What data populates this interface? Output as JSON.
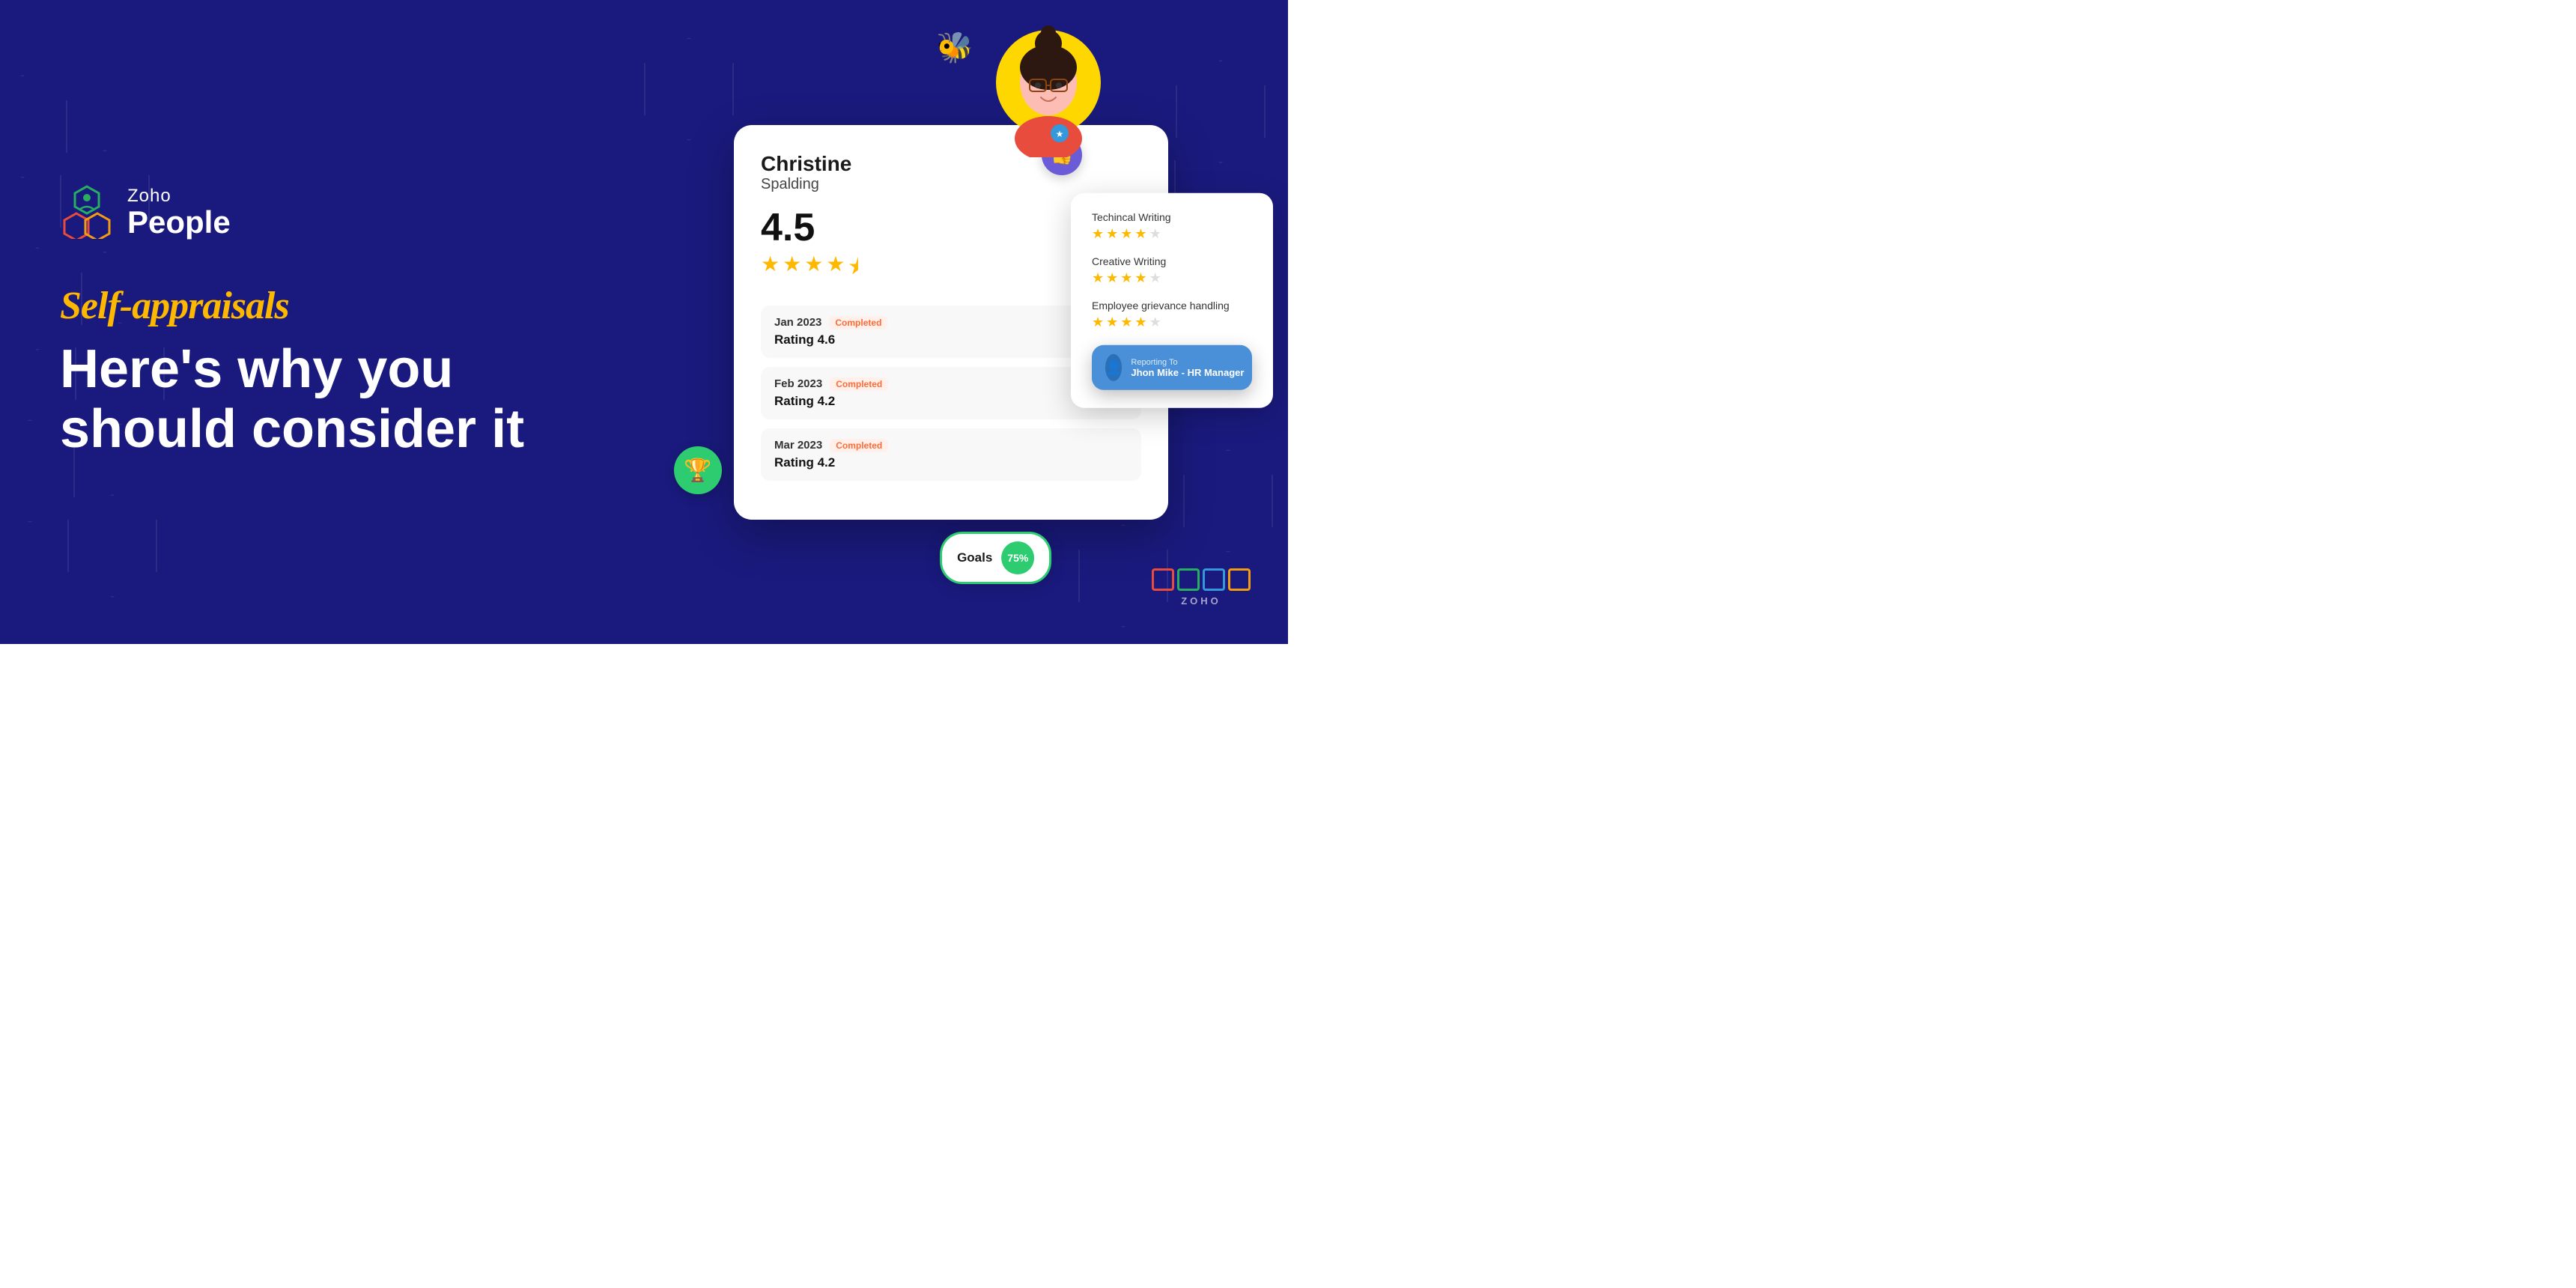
{
  "brand": {
    "zoho": "Zoho",
    "people": "People"
  },
  "hero": {
    "tagline_script": "Self-appraisals",
    "tagline_line1": "Here's why you",
    "tagline_line2": "should consider it"
  },
  "profile": {
    "first_name": "Christine",
    "last_name": "Spalding",
    "overall_rating": "4.5",
    "periods": [
      {
        "month": "Jan 2023",
        "status": "Completed",
        "rating_label": "Rating 4.6"
      },
      {
        "month": "Feb 2023",
        "status": "Completed",
        "rating_label": "Rating 4.2"
      },
      {
        "month": "Mar 2023",
        "status": "Completed",
        "rating_label": "Rating 4.2"
      }
    ]
  },
  "skills": [
    {
      "name": "Techincal Writing",
      "filled": 4,
      "empty": 1
    },
    {
      "name": "Creative Writing",
      "filled": 4,
      "empty": 1
    },
    {
      "name": "Employee grievance handling",
      "filled": 4,
      "empty": 1
    }
  ],
  "reporting": {
    "label": "Reporting To",
    "name": "Jhon Mike",
    "role": "HR Manager"
  },
  "goals": {
    "label": "Goals",
    "percent": "75%"
  },
  "zoho_bottom": "ZOHO"
}
